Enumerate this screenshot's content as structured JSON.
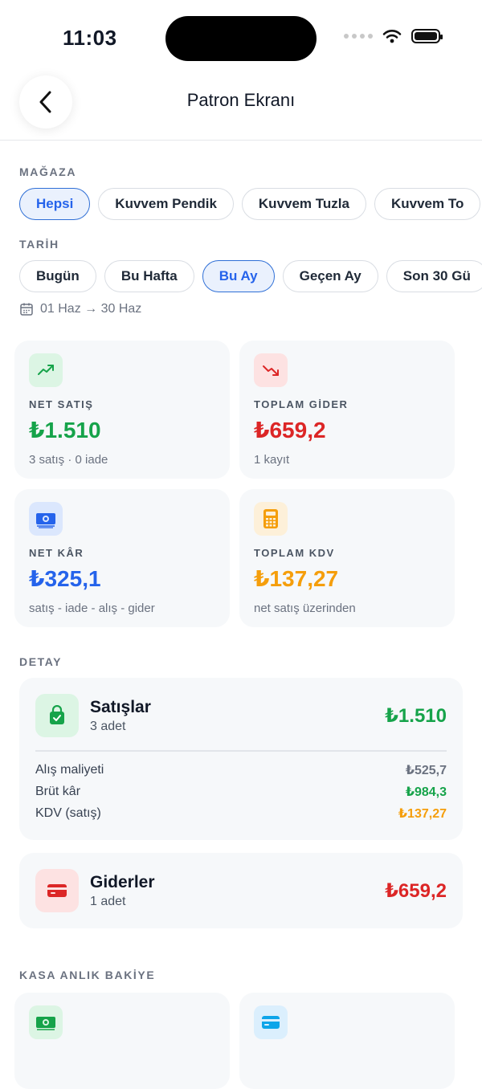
{
  "status": {
    "time": "11:03"
  },
  "header": {
    "title": "Patron Ekranı"
  },
  "store": {
    "label": "MAĞAZA",
    "chips": [
      "Hepsi",
      "Kuvvem Pendik",
      "Kuvvem Tuzla",
      "Kuvvem To"
    ],
    "selected": "Hepsi"
  },
  "date": {
    "label": "TARİH",
    "chips": [
      "Bugün",
      "Bu Hafta",
      "Bu Ay",
      "Geçen Ay",
      "Son 30 Gü"
    ],
    "selected": "Bu Ay",
    "range": "01 Haz → 30 Haz"
  },
  "summary": {
    "net_sales": {
      "label": "NET SATIŞ",
      "value": "₺1.510",
      "sub": "3 satış · 0 iade",
      "color": "#16a34a"
    },
    "total_expense": {
      "label": "TOPLAM GİDER",
      "value": "₺659,2",
      "sub": "1 kayıt",
      "color": "#dc2626"
    },
    "net_profit": {
      "label": "NET KÂR",
      "value": "₺325,1",
      "sub": "satış - iade - alış - gider",
      "color": "#2563eb"
    },
    "total_vat": {
      "label": "TOPLAM KDV",
      "value": "₺137,27",
      "sub": "net satış üzerinden",
      "color": "#f59e0b"
    }
  },
  "detail": {
    "label": "DETAY",
    "sales": {
      "title": "Satışlar",
      "count": "3 adet",
      "value": "₺1.510",
      "rows": [
        {
          "label": "Alış maliyeti",
          "value": "₺525,7"
        },
        {
          "label": "Brüt kâr",
          "value": "₺984,3"
        },
        {
          "label": "KDV (satış)",
          "value": "₺137,27"
        }
      ]
    },
    "expenses": {
      "title": "Giderler",
      "count": "1 adet",
      "value": "₺659,2"
    }
  },
  "cash": {
    "label": "KASA ANLIK BAKİYE"
  },
  "icons": {
    "back": "chevron-left-icon",
    "net_sales": "trending-up-icon",
    "total_expense": "trending-down-icon",
    "net_profit": "banknote-icon",
    "total_vat": "calculator-icon",
    "sales": "shopping-bag-icon",
    "expenses": "credit-card-icon",
    "calendar": "calendar-icon"
  }
}
